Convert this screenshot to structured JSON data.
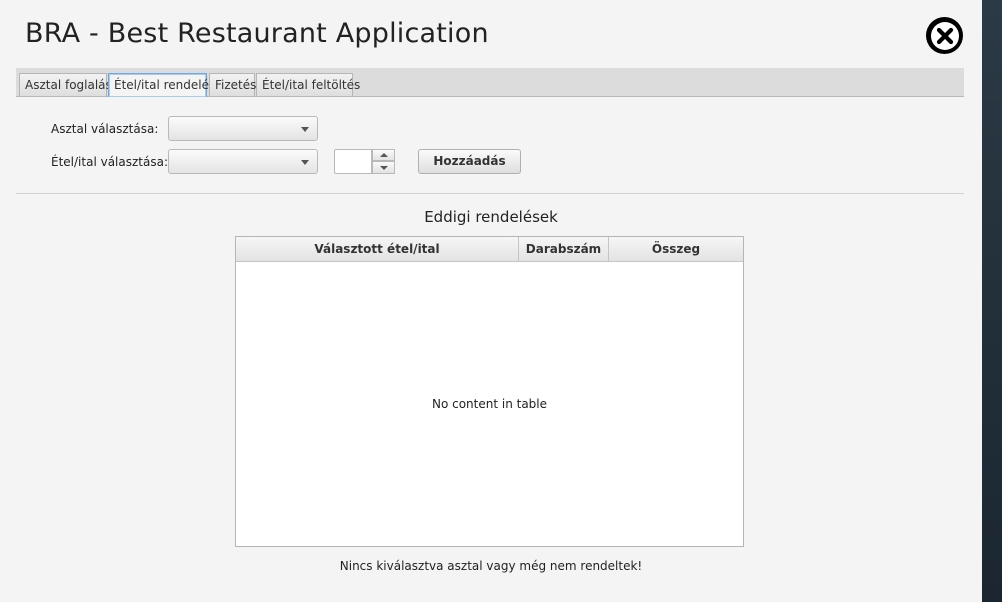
{
  "app": {
    "title": "BRA - Best Restaurant Application"
  },
  "tabs": [
    {
      "label": "Asztal foglalás",
      "active": false
    },
    {
      "label": "Étel/ital rendelés",
      "active": true
    },
    {
      "label": "Fizetés",
      "active": false
    },
    {
      "label": "Étel/ital feltöltés",
      "active": false
    }
  ],
  "form": {
    "table_label": "Asztal választása:",
    "table_value": "",
    "item_label": "Étel/ital választása:",
    "item_value": "",
    "quantity_value": "",
    "add_button": "Hozzáadás"
  },
  "orders": {
    "title": "Eddigi rendelések",
    "columns": [
      "Választott étel/ital",
      "Darabszám",
      "Összeg"
    ],
    "rows": [],
    "empty_text": "No content in table"
  },
  "status_text": "Nincs kiválasztva asztal vagy még nem rendeltek!",
  "icons": {
    "close": "close-circle-icon"
  },
  "colors": {
    "active_tab_border": "#6fa8dc",
    "close_bg": "#000000"
  }
}
